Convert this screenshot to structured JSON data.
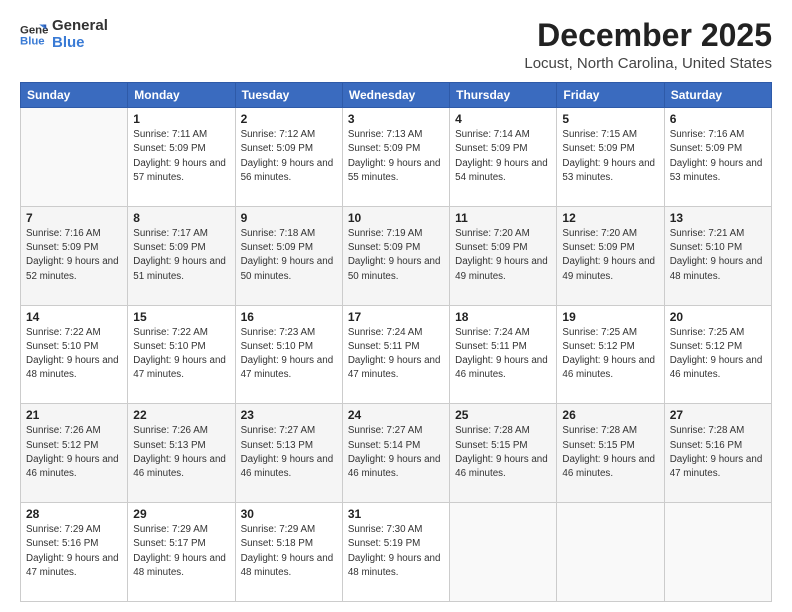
{
  "header": {
    "logo_general": "General",
    "logo_blue": "Blue",
    "month": "December 2025",
    "location": "Locust, North Carolina, United States"
  },
  "weekdays": [
    "Sunday",
    "Monday",
    "Tuesday",
    "Wednesday",
    "Thursday",
    "Friday",
    "Saturday"
  ],
  "weeks": [
    [
      {
        "day": "",
        "sunrise": "",
        "sunset": "",
        "daylight": ""
      },
      {
        "day": "1",
        "sunrise": "Sunrise: 7:11 AM",
        "sunset": "Sunset: 5:09 PM",
        "daylight": "Daylight: 9 hours and 57 minutes."
      },
      {
        "day": "2",
        "sunrise": "Sunrise: 7:12 AM",
        "sunset": "Sunset: 5:09 PM",
        "daylight": "Daylight: 9 hours and 56 minutes."
      },
      {
        "day": "3",
        "sunrise": "Sunrise: 7:13 AM",
        "sunset": "Sunset: 5:09 PM",
        "daylight": "Daylight: 9 hours and 55 minutes."
      },
      {
        "day": "4",
        "sunrise": "Sunrise: 7:14 AM",
        "sunset": "Sunset: 5:09 PM",
        "daylight": "Daylight: 9 hours and 54 minutes."
      },
      {
        "day": "5",
        "sunrise": "Sunrise: 7:15 AM",
        "sunset": "Sunset: 5:09 PM",
        "daylight": "Daylight: 9 hours and 53 minutes."
      },
      {
        "day": "6",
        "sunrise": "Sunrise: 7:16 AM",
        "sunset": "Sunset: 5:09 PM",
        "daylight": "Daylight: 9 hours and 53 minutes."
      }
    ],
    [
      {
        "day": "7",
        "sunrise": "Sunrise: 7:16 AM",
        "sunset": "Sunset: 5:09 PM",
        "daylight": "Daylight: 9 hours and 52 minutes."
      },
      {
        "day": "8",
        "sunrise": "Sunrise: 7:17 AM",
        "sunset": "Sunset: 5:09 PM",
        "daylight": "Daylight: 9 hours and 51 minutes."
      },
      {
        "day": "9",
        "sunrise": "Sunrise: 7:18 AM",
        "sunset": "Sunset: 5:09 PM",
        "daylight": "Daylight: 9 hours and 50 minutes."
      },
      {
        "day": "10",
        "sunrise": "Sunrise: 7:19 AM",
        "sunset": "Sunset: 5:09 PM",
        "daylight": "Daylight: 9 hours and 50 minutes."
      },
      {
        "day": "11",
        "sunrise": "Sunrise: 7:20 AM",
        "sunset": "Sunset: 5:09 PM",
        "daylight": "Daylight: 9 hours and 49 minutes."
      },
      {
        "day": "12",
        "sunrise": "Sunrise: 7:20 AM",
        "sunset": "Sunset: 5:09 PM",
        "daylight": "Daylight: 9 hours and 49 minutes."
      },
      {
        "day": "13",
        "sunrise": "Sunrise: 7:21 AM",
        "sunset": "Sunset: 5:10 PM",
        "daylight": "Daylight: 9 hours and 48 minutes."
      }
    ],
    [
      {
        "day": "14",
        "sunrise": "Sunrise: 7:22 AM",
        "sunset": "Sunset: 5:10 PM",
        "daylight": "Daylight: 9 hours and 48 minutes."
      },
      {
        "day": "15",
        "sunrise": "Sunrise: 7:22 AM",
        "sunset": "Sunset: 5:10 PM",
        "daylight": "Daylight: 9 hours and 47 minutes."
      },
      {
        "day": "16",
        "sunrise": "Sunrise: 7:23 AM",
        "sunset": "Sunset: 5:10 PM",
        "daylight": "Daylight: 9 hours and 47 minutes."
      },
      {
        "day": "17",
        "sunrise": "Sunrise: 7:24 AM",
        "sunset": "Sunset: 5:11 PM",
        "daylight": "Daylight: 9 hours and 47 minutes."
      },
      {
        "day": "18",
        "sunrise": "Sunrise: 7:24 AM",
        "sunset": "Sunset: 5:11 PM",
        "daylight": "Daylight: 9 hours and 46 minutes."
      },
      {
        "day": "19",
        "sunrise": "Sunrise: 7:25 AM",
        "sunset": "Sunset: 5:12 PM",
        "daylight": "Daylight: 9 hours and 46 minutes."
      },
      {
        "day": "20",
        "sunrise": "Sunrise: 7:25 AM",
        "sunset": "Sunset: 5:12 PM",
        "daylight": "Daylight: 9 hours and 46 minutes."
      }
    ],
    [
      {
        "day": "21",
        "sunrise": "Sunrise: 7:26 AM",
        "sunset": "Sunset: 5:12 PM",
        "daylight": "Daylight: 9 hours and 46 minutes."
      },
      {
        "day": "22",
        "sunrise": "Sunrise: 7:26 AM",
        "sunset": "Sunset: 5:13 PM",
        "daylight": "Daylight: 9 hours and 46 minutes."
      },
      {
        "day": "23",
        "sunrise": "Sunrise: 7:27 AM",
        "sunset": "Sunset: 5:13 PM",
        "daylight": "Daylight: 9 hours and 46 minutes."
      },
      {
        "day": "24",
        "sunrise": "Sunrise: 7:27 AM",
        "sunset": "Sunset: 5:14 PM",
        "daylight": "Daylight: 9 hours and 46 minutes."
      },
      {
        "day": "25",
        "sunrise": "Sunrise: 7:28 AM",
        "sunset": "Sunset: 5:15 PM",
        "daylight": "Daylight: 9 hours and 46 minutes."
      },
      {
        "day": "26",
        "sunrise": "Sunrise: 7:28 AM",
        "sunset": "Sunset: 5:15 PM",
        "daylight": "Daylight: 9 hours and 46 minutes."
      },
      {
        "day": "27",
        "sunrise": "Sunrise: 7:28 AM",
        "sunset": "Sunset: 5:16 PM",
        "daylight": "Daylight: 9 hours and 47 minutes."
      }
    ],
    [
      {
        "day": "28",
        "sunrise": "Sunrise: 7:29 AM",
        "sunset": "Sunset: 5:16 PM",
        "daylight": "Daylight: 9 hours and 47 minutes."
      },
      {
        "day": "29",
        "sunrise": "Sunrise: 7:29 AM",
        "sunset": "Sunset: 5:17 PM",
        "daylight": "Daylight: 9 hours and 48 minutes."
      },
      {
        "day": "30",
        "sunrise": "Sunrise: 7:29 AM",
        "sunset": "Sunset: 5:18 PM",
        "daylight": "Daylight: 9 hours and 48 minutes."
      },
      {
        "day": "31",
        "sunrise": "Sunrise: 7:30 AM",
        "sunset": "Sunset: 5:19 PM",
        "daylight": "Daylight: 9 hours and 48 minutes."
      },
      {
        "day": "",
        "sunrise": "",
        "sunset": "",
        "daylight": ""
      },
      {
        "day": "",
        "sunrise": "",
        "sunset": "",
        "daylight": ""
      },
      {
        "day": "",
        "sunrise": "",
        "sunset": "",
        "daylight": ""
      }
    ]
  ]
}
